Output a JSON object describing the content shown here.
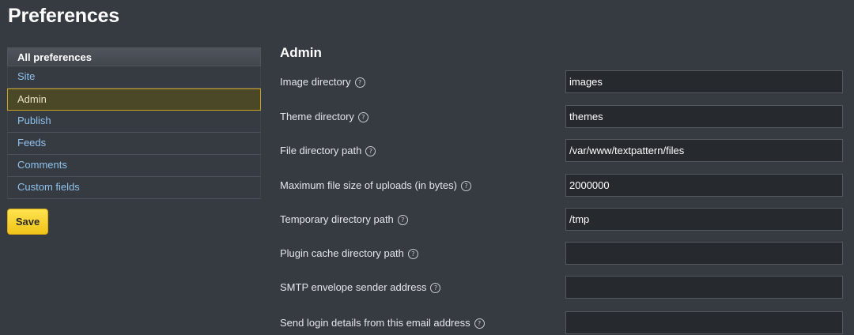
{
  "page": {
    "title": "Preferences"
  },
  "sidebar": {
    "header": "All preferences",
    "items": [
      {
        "label": "Site"
      },
      {
        "label": "Admin",
        "active": true
      },
      {
        "label": "Publish"
      },
      {
        "label": "Feeds"
      },
      {
        "label": "Comments"
      },
      {
        "label": "Custom fields"
      }
    ]
  },
  "actions": {
    "save_label": "Save"
  },
  "section": {
    "title": "Admin",
    "help_glyph": "?",
    "fields": [
      {
        "label": "Image directory",
        "value": "images"
      },
      {
        "label": "Theme directory",
        "value": "themes"
      },
      {
        "label": "File directory path",
        "value": "/var/www/textpattern/files"
      },
      {
        "label": "Maximum file size of uploads (in bytes)",
        "value": "2000000"
      },
      {
        "label": "Temporary directory path",
        "value": "/tmp"
      },
      {
        "label": "Plugin cache directory path",
        "value": ""
      },
      {
        "label": "SMTP envelope sender address",
        "value": ""
      },
      {
        "label": "Send login details from this email address",
        "value": ""
      }
    ]
  },
  "colors": {
    "background": "#363a41",
    "accent": "#f0c419",
    "link": "#8fc3ee",
    "active_border": "#c9a51e"
  }
}
